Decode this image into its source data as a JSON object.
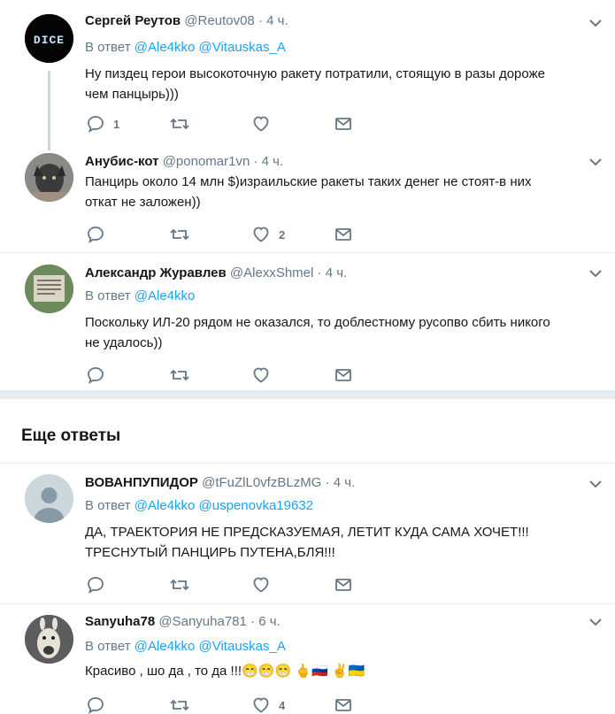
{
  "tweets": [
    {
      "name": "Сергей Реутов",
      "handle": "@Reutov08",
      "time": "4 ч.",
      "reply_prefix": "В ответ",
      "mentions": [
        "@Ale4kko",
        "@Vitauskas_A"
      ],
      "lines": [
        "Ну пиздец герои высокоточную ракету потратили, стоящую в разы дороже",
        "чем панцырь)))"
      ],
      "reply_count": "1",
      "retweet_count": "",
      "like_count": "",
      "avatar_text": "DICE"
    },
    {
      "name": "Анубис-кот",
      "handle": "@ponomar1vn",
      "time": "4 ч.",
      "lines": [
        "Панцирь около 14 млн $)израильские ракеты таких денег не стоят-в них",
        "откат не заложен))"
      ],
      "reply_count": "",
      "retweet_count": "",
      "like_count": "2"
    },
    {
      "name": "Александр Журавлев",
      "handle": "@AlexxShmel",
      "time": "4 ч.",
      "reply_prefix": "В ответ",
      "mentions": [
        "@Ale4kko"
      ],
      "lines": [
        "Поскольку ИЛ-20 рядом не оказался, то доблестному русопво сбить никого",
        "не удалось))"
      ],
      "reply_count": "",
      "retweet_count": "",
      "like_count": ""
    }
  ],
  "more_replies_title": "Еще ответы",
  "more": [
    {
      "name": "ВОВАНПУПИДОР",
      "handle": "@tFuZlL0vfzBLzMG",
      "time": "4 ч.",
      "reply_prefix": "В ответ",
      "mentions": [
        "@Ale4kko",
        "@uspenovka19632"
      ],
      "lines": [
        "ДА, ТРАЕКТОРИЯ НЕ ПРЕДСКАЗУЕМАЯ, ЛЕТИТ КУДА САМА ХОЧЕТ!!!",
        "ТРЕСНУТЫЙ ПАНЦИРЬ ПУТЕНА,БЛЯ!!!"
      ],
      "reply_count": "",
      "retweet_count": "",
      "like_count": ""
    },
    {
      "name": "Sanyuha78",
      "handle": "@Sanyuha781",
      "time": "6 ч.",
      "reply_prefix": "В ответ",
      "mentions": [
        "@Ale4kko",
        "@Vitauskas_A"
      ],
      "text_prefix": "Красиво , шо да , то да !!!",
      "emoji": [
        "😁",
        "😁",
        "😁",
        "🖕",
        "🇷🇺",
        "✌",
        "🇺🇦"
      ],
      "reply_count": "",
      "retweet_count": "",
      "like_count": "4"
    }
  ],
  "colors": {
    "accent": "#1da1f2",
    "muted": "#657786",
    "separator": "#e6ecf0",
    "section_bg": "#e6ecf0"
  },
  "icons": [
    "reply-icon",
    "retweet-icon",
    "like-icon",
    "dm-icon",
    "caret-down-icon"
  ]
}
